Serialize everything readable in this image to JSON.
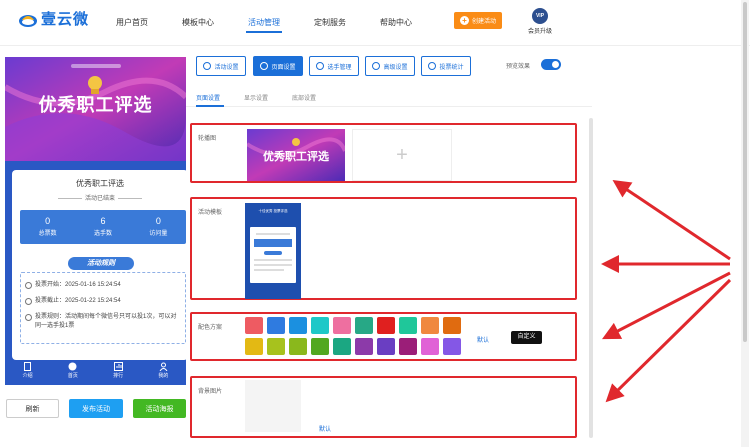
{
  "header": {
    "logo_text": "壹云微",
    "nav": [
      "用户首页",
      "模板中心",
      "活动管理",
      "定制服务",
      "帮助中心"
    ],
    "active_nav": "活动管理",
    "create_label": "创建活动",
    "vip_badge": "VIP",
    "vip_label": "会员升级"
  },
  "preview": {
    "banner_title": "优秀职工评选",
    "activity_title": "优秀职工评选",
    "status": "活动已结束",
    "stats": [
      {
        "value": "0",
        "label": "总票数"
      },
      {
        "value": "6",
        "label": "选手数"
      },
      {
        "value": "0",
        "label": "访问量"
      }
    ],
    "rules_label": "活动规则",
    "info": [
      "投票开始：2025-01-16 15:24:54",
      "投票截止：2025-01-22 15:24:54",
      "投票规则：活动期间每个微信号只可以投1次，可以对同一选手投1票"
    ],
    "tabs": [
      "介绍",
      "首页",
      "排行",
      "我的"
    ]
  },
  "bottom_buttons": {
    "refresh": "刷新",
    "publish": "发布活动",
    "poster": "活动海报"
  },
  "toolbar": {
    "buttons": [
      "活动设置",
      "页面设置",
      "选手管理",
      "高级设置",
      "投票统计"
    ],
    "active": "页面设置",
    "preview_label": "预览效果",
    "preview_enabled": true
  },
  "subtabs": {
    "items": [
      "页面设置",
      "显示设置",
      "底部设置"
    ],
    "active": "页面设置"
  },
  "sections": {
    "carousel_label": "轮播图",
    "carousel_image_text": "优秀职工评选",
    "template_label": "活动模板",
    "template_title": "十佳优秀 投票评选",
    "color_label": "配色方案",
    "colors": [
      "#ee5b62",
      "#2f7be0",
      "#1b90e0",
      "#1ec8c8",
      "#ee6fa0",
      "#27a886",
      "#e0201f",
      "#1fc79a",
      "#f0883f",
      "#e06b10",
      "#e3b914",
      "#a7c21d",
      "#8ab81c",
      "#52a820",
      "#1ba782",
      "#8c3aa9",
      "#6a3ec2",
      "#9b1e78",
      "#e061d6",
      "#8457e6"
    ],
    "color_default": "默认",
    "color_custom": "自定义",
    "bg_label": "背景图片",
    "bg_default": "默认"
  }
}
